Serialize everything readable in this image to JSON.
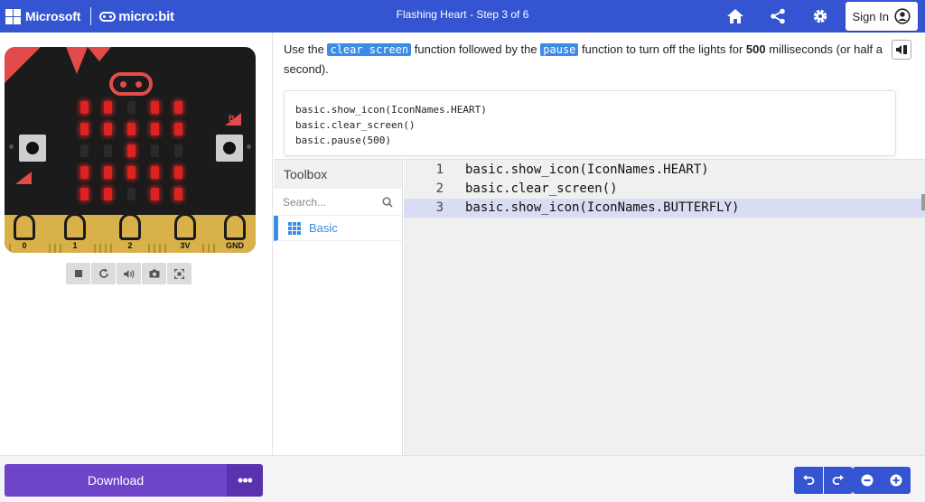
{
  "header": {
    "brand": "Microsoft",
    "product": "micro:bit",
    "title": "Flashing Heart",
    "step": "Step 3 of 6",
    "signin_label": "Sign In",
    "icons": [
      "home-icon",
      "share-icon",
      "gear-icon",
      "user-circle-icon"
    ]
  },
  "simulator": {
    "button_a": "A",
    "button_b": "B",
    "pins": [
      "0",
      "1",
      "2",
      "3V",
      "GND"
    ],
    "led_matrix": [
      [
        1,
        1,
        0,
        1,
        1
      ],
      [
        1,
        1,
        1,
        1,
        1
      ],
      [
        0,
        0,
        1,
        0,
        0
      ],
      [
        1,
        1,
        1,
        1,
        1
      ],
      [
        1,
        1,
        0,
        1,
        1
      ]
    ],
    "toolbar_icons": [
      "stop-icon",
      "restart-icon",
      "sound-icon",
      "screenshot-icon",
      "fullscreen-icon"
    ]
  },
  "tutorial": {
    "text_before": "Use the",
    "fn1": "clear screen",
    "text_middle": "function followed by the",
    "fn2": "pause",
    "text_after": "function to turn off the lights for",
    "ms_value": "500",
    "text_end": "milliseconds (or half a second).",
    "hint_lines": [
      "basic.show_icon(IconNames.HEART)",
      "basic.clear_screen()",
      "basic.pause(500)"
    ]
  },
  "toolbox": {
    "title": "Toolbox",
    "search_placeholder": "Search...",
    "categories": [
      {
        "label": "Basic",
        "color": "#3b8ce6"
      }
    ]
  },
  "editor": {
    "lines": [
      {
        "num": "1",
        "code": "basic.show_icon(IconNames.HEART)"
      },
      {
        "num": "2",
        "code": "basic.clear_screen()"
      },
      {
        "num": "3",
        "code": "basic.show_icon(IconNames.BUTTERFLY)"
      }
    ],
    "active_line": 3
  },
  "footer": {
    "download_label": "Download",
    "more_label": "•••",
    "buttons": [
      "undo-icon",
      "redo-icon",
      "zoom-out-icon",
      "zoom-in-icon"
    ]
  },
  "colors": {
    "header": "#3454d1",
    "download": "#6e44c9",
    "highlight": "#3b8ce6",
    "led_on": "#dd2222"
  }
}
